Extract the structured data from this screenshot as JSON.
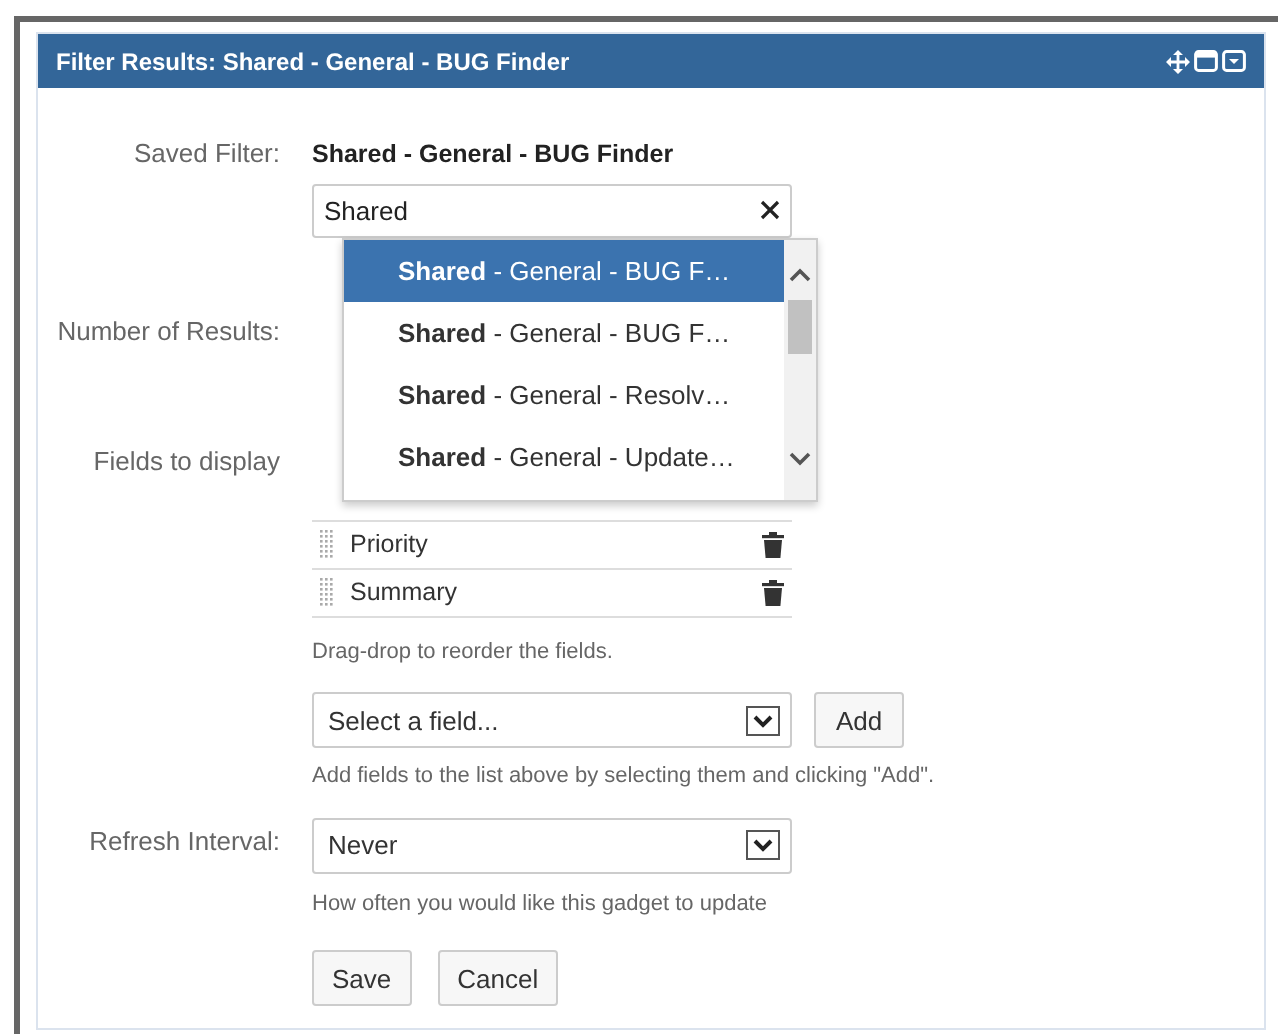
{
  "panel": {
    "title": "Filter Results: Shared - General - BUG Finder"
  },
  "saved_filter": {
    "label": "Saved Filter:",
    "current": "Shared - General - BUG Finder",
    "search_value": "Shared",
    "options": [
      {
        "text": "**Shared** - General - BUG F…",
        "selected": true
      },
      {
        "text": "**Shared** - General - BUG F…",
        "selected": false
      },
      {
        "text": "**Shared** - General - Resolv…",
        "selected": false
      },
      {
        "text": "**Shared** - General - Update…",
        "selected": false
      }
    ]
  },
  "number_of_results": {
    "label": "Number of Results:"
  },
  "fields": {
    "label": "Fields to display",
    "items": [
      "Priority",
      "Summary"
    ],
    "hint": "Drag-drop to reorder the fields.",
    "select_value": "Select a field...",
    "add_button": "Add",
    "add_hint": "Add fields to the list above by selecting them and clicking \"Add\"."
  },
  "refresh": {
    "label": "Refresh Interval:",
    "value": "Never",
    "hint": "How often you would like this gadget to update"
  },
  "buttons": [
    "Save",
    "Cancel"
  ]
}
